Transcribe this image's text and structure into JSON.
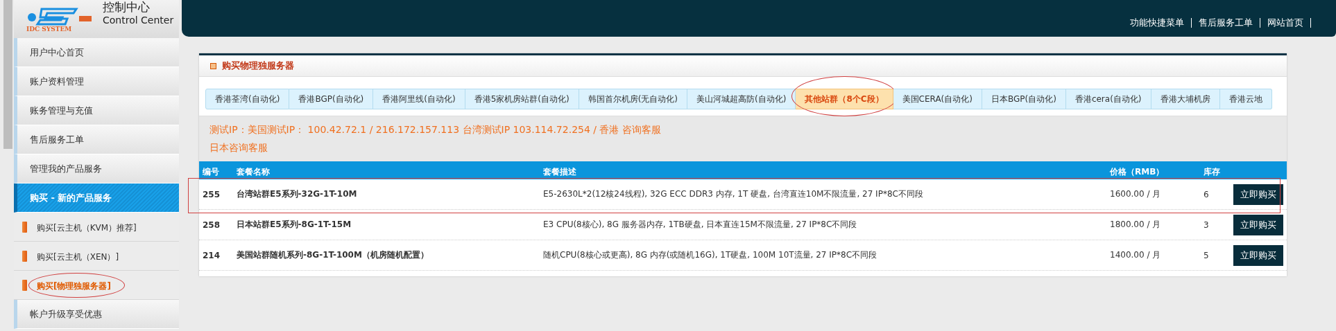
{
  "logo": {
    "brand": "IDC SYSTEM",
    "title": "控制中心",
    "subtitle": "Control Center"
  },
  "header": {
    "links": [
      "功能快捷菜单",
      "售后服务工单",
      "网站首页"
    ]
  },
  "sidebar": {
    "items": [
      {
        "label": "用户中心首页",
        "kind": "main",
        "selected": false,
        "circled": false
      },
      {
        "label": "账户资料管理",
        "kind": "main",
        "selected": false,
        "circled": false
      },
      {
        "label": "账务管理与充值",
        "kind": "main",
        "selected": false,
        "circled": false
      },
      {
        "label": "售后服务工单",
        "kind": "main",
        "selected": false,
        "circled": false
      },
      {
        "label": "管理我的产品服务",
        "kind": "main",
        "selected": false,
        "circled": false
      },
      {
        "label": "购买 - 新的产品服务",
        "kind": "main",
        "selected": true,
        "circled": false
      },
      {
        "label": "购买[云主机（KVM）推荐]",
        "kind": "sub",
        "selected": false,
        "circled": false
      },
      {
        "label": "购买[云主机（XEN）]",
        "kind": "sub",
        "selected": false,
        "circled": false
      },
      {
        "label": "购买[物理独服务器]",
        "kind": "sub",
        "selected": true,
        "circled": true
      },
      {
        "label": "帐户升级享受优惠",
        "kind": "main",
        "selected": false,
        "circled": false
      }
    ]
  },
  "panel": {
    "title": "购买物理独服务器",
    "tabs": [
      {
        "label": "香港荃湾(自动化)",
        "selected": false,
        "circled": false
      },
      {
        "label": "香港BGP(自动化)",
        "selected": false,
        "circled": false
      },
      {
        "label": "香港阿里线(自动化)",
        "selected": false,
        "circled": false
      },
      {
        "label": "香港5家机房站群(自动化)",
        "selected": false,
        "circled": false
      },
      {
        "label": "韩国首尔机房(无自动化)",
        "selected": false,
        "circled": false
      },
      {
        "label": "美山河城超高防(自动化)",
        "selected": false,
        "circled": false
      },
      {
        "label": "其他站群（8个C段）",
        "selected": true,
        "circled": true
      },
      {
        "label": "美国CERA(自动化)",
        "selected": false,
        "circled": false
      },
      {
        "label": "日本BGP(自动化)",
        "selected": false,
        "circled": false
      },
      {
        "label": "香港cera(自动化)",
        "selected": false,
        "circled": false
      },
      {
        "label": "香港大埔机房",
        "selected": false,
        "circled": false
      },
      {
        "label": "香港云地",
        "selected": false,
        "circled": false
      }
    ],
    "info_lines": [
      "测试IP：美国测试IP： 100.42.72.1 / 216.172.157.113 台湾测试IP 103.114.72.254 / 香港 咨询客服",
      "日本咨询客服"
    ],
    "table": {
      "columns": [
        "编号",
        "套餐名称",
        "套餐描述",
        "价格（RMB）",
        "库存"
      ],
      "rows": [
        {
          "id": "255",
          "name": "台湾站群E5系列-32G-1T-10M",
          "description": "E5-2630L*2(12核24线程), 32G ECC DDR3 内存, 1T 硬盘, 台湾直连10M不限流量, 27 IP*8C不同段",
          "price": "1600.00 / 月",
          "stock": "6",
          "button": "立即购买",
          "boxed": true
        },
        {
          "id": "258",
          "name": "日本站群E5系列-8G-1T-15M",
          "description": "E3 CPU(8核心), 8G 服务器内存, 1TB硬盘, 日本直连15M不限流量, 27 IP*8C不同段",
          "price": "1800.00 / 月",
          "stock": "3",
          "button": "立即购买",
          "boxed": false
        },
        {
          "id": "214",
          "name": "美国站群随机系列-8G-1T-100M（机房随机配置）",
          "description": "随机CPU(8核心或更高), 8G 内存(或随机16G), 1T硬盘, 100M 10T流量, 27 IP*8C不同段",
          "price": "1400.00 / 月",
          "stock": "5",
          "button": "立即购买",
          "boxed": false
        }
      ]
    }
  }
}
